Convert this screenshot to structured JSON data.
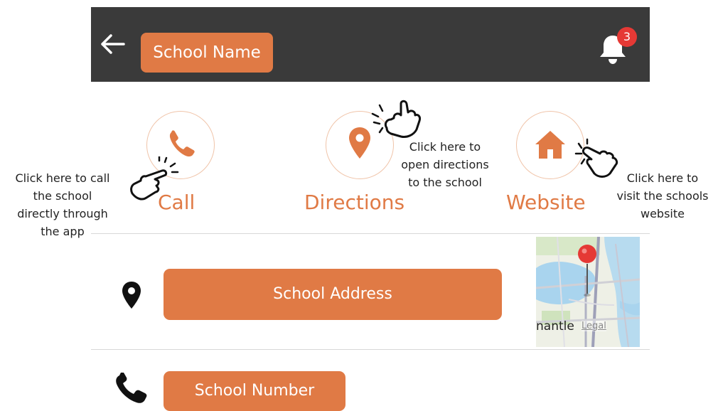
{
  "header": {
    "title": "School Name",
    "notification_count": "3",
    "bg_color": "#3a3a3a"
  },
  "actions": {
    "call": {
      "label": "Call",
      "icon": "phone-icon"
    },
    "directions": {
      "label": "Directions",
      "icon": "map-pin-icon"
    },
    "website": {
      "label": "Website",
      "icon": "home-icon"
    }
  },
  "annotations": {
    "call": [
      "Click here to call",
      "the school",
      "directly through",
      "the app"
    ],
    "directions": [
      "Click here to",
      "open directions",
      "to the school"
    ],
    "website": [
      "Click here to",
      "visit the schools",
      "website"
    ]
  },
  "details": {
    "address_label": "School Address",
    "number_label": "School Number"
  },
  "map": {
    "place_fragment": "nantle",
    "legal": "Legal"
  },
  "colors": {
    "accent": "#e07a45",
    "badge": "#e53935"
  }
}
